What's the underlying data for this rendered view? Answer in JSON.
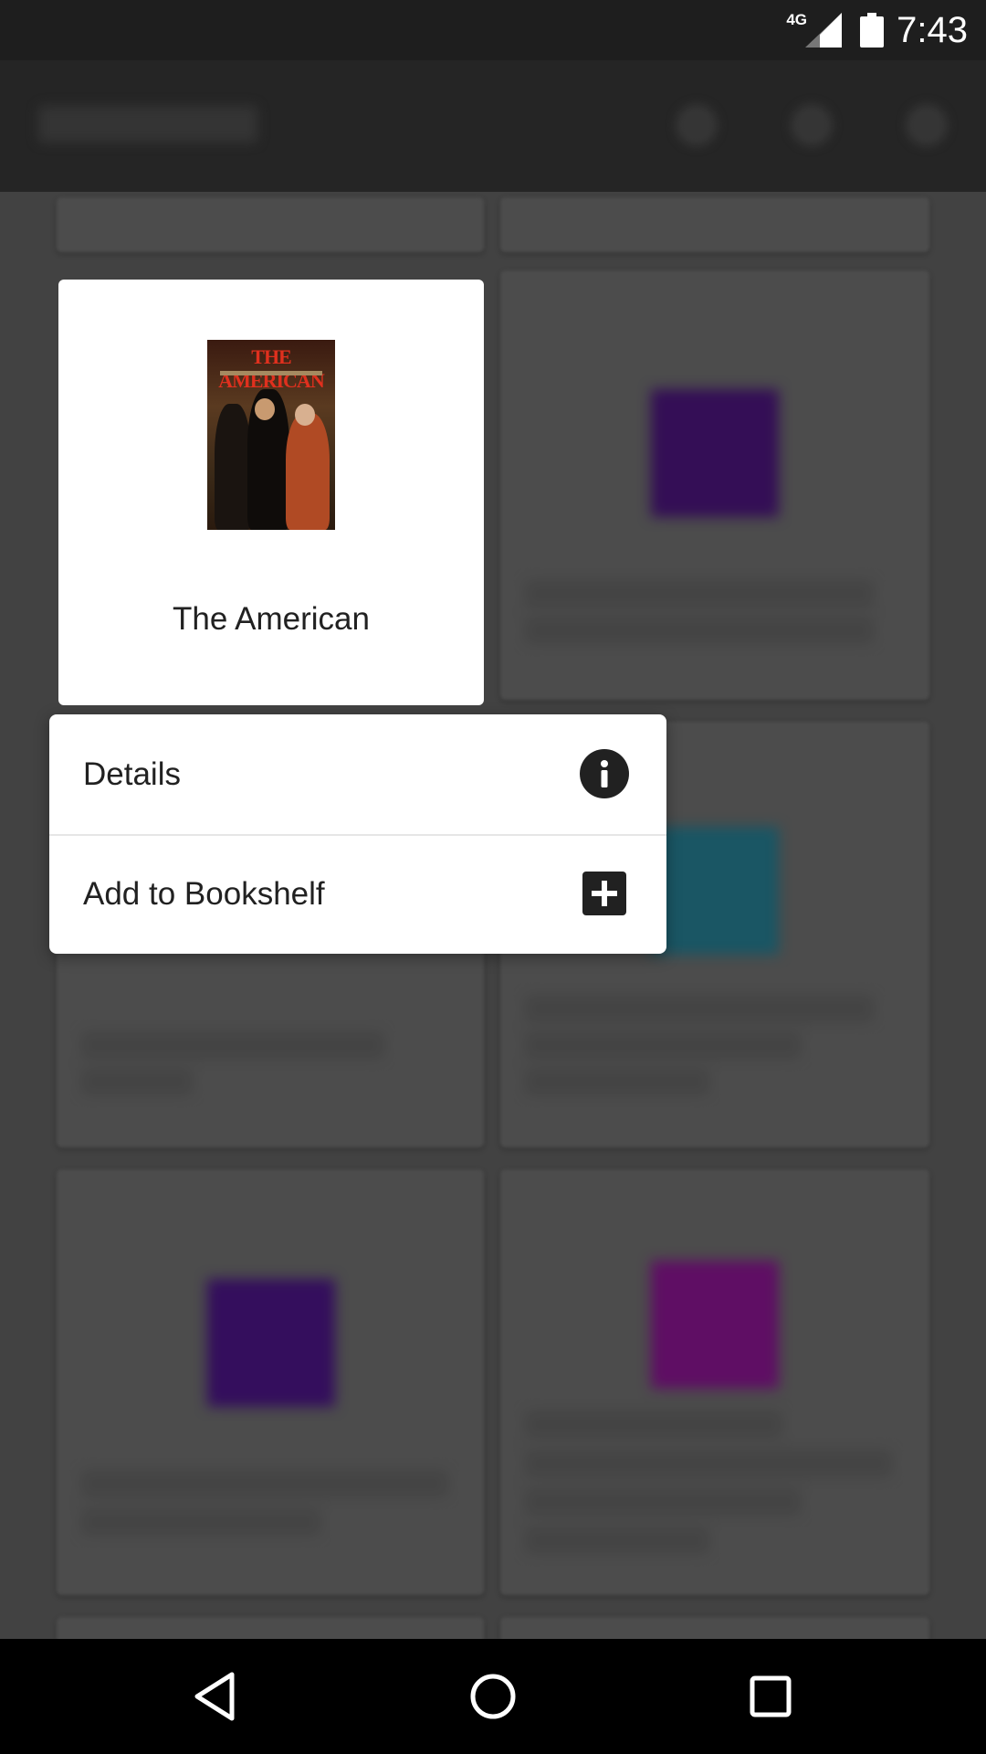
{
  "status_bar": {
    "network": "4G",
    "time": "7:43"
  },
  "book": {
    "title": "The American",
    "cover_title": "THE AMERICAN"
  },
  "context_menu": {
    "items": [
      {
        "label": "Details",
        "icon": "info-icon"
      },
      {
        "label": "Add to Bookshelf",
        "icon": "add-box-icon"
      }
    ]
  },
  "nav_bar": {
    "back": "back-icon",
    "home": "home-icon",
    "recents": "recents-icon"
  },
  "colors": {
    "status_bar": "#1e1e1e",
    "app_bar_dimmed": "#2a2a2a",
    "background_dimmed": "#4a4a4a",
    "card": "#ffffff",
    "text": "#212121",
    "icon": "#212121",
    "nav_bar": "#000000"
  }
}
